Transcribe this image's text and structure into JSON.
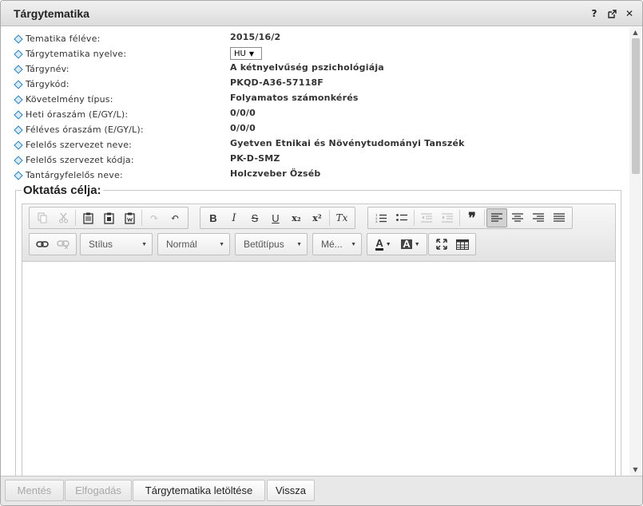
{
  "window": {
    "title": "Tárgytematika",
    "icons": [
      "help-icon",
      "popout-icon",
      "close-icon"
    ],
    "help_glyph": "?",
    "close_glyph": "✕"
  },
  "info": [
    {
      "label": "Tematika féléve:",
      "value": "2015/16/2"
    },
    {
      "label": "Tárgytematika nyelve:",
      "value": "HU"
    },
    {
      "label": "Tárgynév:",
      "value": "A kétnyelvűség pszichológiája"
    },
    {
      "label": "Tárgykód:",
      "value": "PKQD-A36-57118F"
    },
    {
      "label": "Követelmény típus:",
      "value": "Folyamatos számonkérés"
    },
    {
      "label": "Heti óraszám (E/GY/L):",
      "value": "0/0/0"
    },
    {
      "label": "Féléves óraszám (E/GY/L):",
      "value": "0/0/0"
    },
    {
      "label": "Felelős szervezet neve:",
      "value": "Gyetven Etnikai és Növénytudományi Tanszék"
    },
    {
      "label": "Felelős szervezet kódja:",
      "value": "PK-D-SMZ"
    },
    {
      "label": "Tantárgyfelelős neve:",
      "value": "Holczveber Özséb"
    }
  ],
  "section": {
    "title": "Oktatás célja:"
  },
  "editor": {
    "combos": {
      "style": "Stílus",
      "format": "Normál",
      "font": "Betűtípus",
      "size": "Mé..."
    },
    "body_text": "",
    "glyphs": {
      "bold": "B",
      "italic": "I",
      "strike": "S",
      "underline": "U",
      "subscript": "x₂",
      "superscript": "x²",
      "remove_format": "Tx",
      "quote": "❞",
      "text_color": "A",
      "bg_color": "A",
      "undo": "↶",
      "redo": "↷"
    }
  },
  "footer": {
    "save": "Mentés",
    "accept": "Elfogadás",
    "download": "Tárgytematika letöltése",
    "back": "Vissza"
  }
}
